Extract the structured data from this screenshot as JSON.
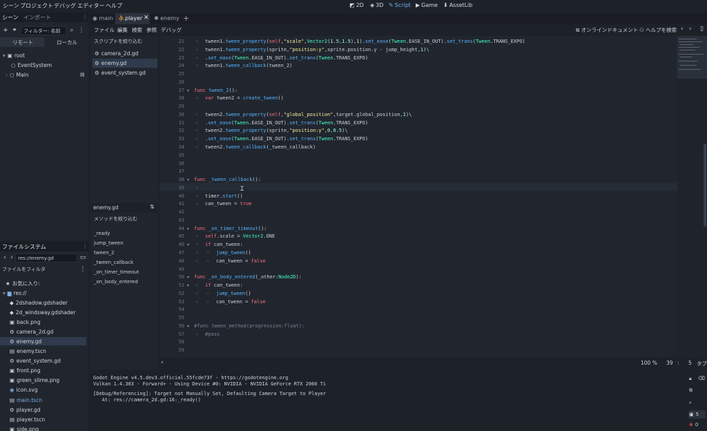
{
  "menubar": {
    "items": [
      "シーン",
      "プロジェクト",
      "デバッグ",
      "エディター",
      "ヘルプ"
    ],
    "workspaces": [
      {
        "label": "2D",
        "active": false
      },
      {
        "label": "3D",
        "active": false
      },
      {
        "label": "Script",
        "active": true
      },
      {
        "label": "Game",
        "active": false
      },
      {
        "label": "AssetLib",
        "active": false
      }
    ]
  },
  "scene_dock": {
    "tabs": [
      "シーン",
      "インポート"
    ],
    "filter_placeholder": "フィルター: 名前",
    "remote_label": "リモート",
    "local_label": "ローカル",
    "tree": [
      {
        "name": "root",
        "depth": 0
      },
      {
        "name": "EventSystem",
        "depth": 1
      },
      {
        "name": "Main",
        "depth": 1
      }
    ]
  },
  "scene_tabs": [
    {
      "label": "main",
      "active": false
    },
    {
      "label": "player",
      "active": true
    },
    {
      "label": "enemy",
      "active": false
    }
  ],
  "script_menu": [
    "ファイル",
    "編集",
    "検索",
    "参照",
    "デバッグ"
  ],
  "script_toolbar": {
    "online_docs": "オンラインドキュメント",
    "help_search": "ヘルプを検索"
  },
  "script_list": {
    "filter_placeholder": "スクリプトを絞り込む",
    "items": [
      "camera_2d.gd",
      "enemy.gd",
      "event_system.gd"
    ],
    "selected": 1,
    "current_file": "enemy.gd",
    "method_filter_placeholder": "メソッドを絞り込む",
    "methods": [
      "_ready",
      "jump_tween",
      "tween_2",
      "_tween_callback",
      "_on_timer_timeout",
      "_on_body_entered"
    ]
  },
  "editor": {
    "lines": [
      {
        "n": "21",
        "indent": 1,
        "html": "tween1.<span class='fn'>tween_property</span>(<span class='kw'>self</span>,<span class='str'>\"scale\"</span>,<span class='ty'>Vector2</span>(<span class='num'>1.5</span>,<span class='num'>1.5</span>),<span class='num'>1</span>).<span class='fn'>set_ease</span>(<span class='ty'>Tween</span>.EASE_IN_OUT).<span class='fn'>set_trans</span>(<span class='ty'>Tween</span>.TRANS_EXPO)"
      },
      {
        "n": "22",
        "indent": 1,
        "html": "tween1.<span class='fn'>tween_property</span>(sprite,<span class='str'>\"position:y\"</span>,sprite.position.y - jump_height,<span class='num'>1</span>)\\"
      },
      {
        "n": "23",
        "indent": 1,
        "html": ".<span class='fn'>set_ease</span>(<span class='ty'>Tween</span>.EASE_IN_OUT).<span class='fn'>set_trans</span>(<span class='ty'>Tween</span>.TRANS_EXPO)"
      },
      {
        "n": "24",
        "indent": 1,
        "html": "tween1.<span class='fn'>tween_callback</span>(tween_2)"
      },
      {
        "n": "25",
        "indent": 0,
        "html": ""
      },
      {
        "n": "26",
        "indent": 0,
        "html": ""
      },
      {
        "n": "27",
        "indent": 0,
        "fold": true,
        "html": "<span class='kw'>func</span> <span class='fn'>tween_2</span>():"
      },
      {
        "n": "28",
        "indent": 1,
        "html": "<span class='kw'>var</span> tween2 = <span class='fn'>create_tween</span>()"
      },
      {
        "n": "29",
        "indent": 0,
        "html": ""
      },
      {
        "n": "30",
        "indent": 1,
        "html": "tween2.<span class='fn'>tween_property</span>(<span class='kw'>self</span>,<span class='str'>\"global_position\"</span>,target.global_position,<span class='num'>1</span>)\\"
      },
      {
        "n": "31",
        "indent": 1,
        "html": ".<span class='fn'>set_ease</span>(<span class='ty'>Tween</span>.EASE_IN_OUT).<span class='fn'>set_trans</span>(<span class='ty'>Tween</span>.TRANS_EXPO)"
      },
      {
        "n": "32",
        "indent": 1,
        "html": "tween2.<span class='fn'>tween_property</span>(sprite,<span class='str'>\"position:y\"</span>,<span class='num'>0</span>,<span class='num'>0.5</span>)\\"
      },
      {
        "n": "33",
        "indent": 1,
        "html": ".<span class='fn'>set_ease</span>(<span class='ty'>Tween</span>.EASE_IN_OUT).<span class='fn'>set_trans</span>(<span class='ty'>Tween</span>.TRANS_EXPO)"
      },
      {
        "n": "34",
        "indent": 1,
        "html": "tween2.<span class='fn'>tween_callback</span>(_tween_callback)"
      },
      {
        "n": "35",
        "indent": 0,
        "html": ""
      },
      {
        "n": "36",
        "indent": 0,
        "html": ""
      },
      {
        "n": "37",
        "indent": 0,
        "html": ""
      },
      {
        "n": "38",
        "indent": 0,
        "fold": true,
        "html": "<span class='kw'>func</span> <span class='fn'>_tween_callback</span>():"
      },
      {
        "n": "39",
        "indent": 1,
        "current": true,
        "html": ""
      },
      {
        "n": "40",
        "indent": 1,
        "html": "timer.<span class='fn'>start</span>()"
      },
      {
        "n": "41",
        "indent": 1,
        "html": "can_tween = <span class='kw'>true</span>"
      },
      {
        "n": "42",
        "indent": 0,
        "html": ""
      },
      {
        "n": "43",
        "indent": 0,
        "html": ""
      },
      {
        "n": "44",
        "indent": 0,
        "fold": true,
        "html": "<span class='kw'>func</span> <span class='fn'>_on_timer_timeout</span>():"
      },
      {
        "n": "45",
        "indent": 1,
        "html": "<span class='kw'>self</span>.scale = <span class='ty'>Vector2</span>.ONE"
      },
      {
        "n": "46",
        "indent": 1,
        "fold": true,
        "html": "<span class='kw'>if</span> can_tween:"
      },
      {
        "n": "47",
        "indent": 2,
        "html": "<span class='fn'>jump_tween</span>()"
      },
      {
        "n": "48",
        "indent": 2,
        "html": "can_tween = <span class='kw'>false</span>"
      },
      {
        "n": "49",
        "indent": 0,
        "html": ""
      },
      {
        "n": "50",
        "indent": 0,
        "fold": true,
        "html": "<span class='kw'>func</span> <span class='fn'>_on_body_entered</span>(_other:<span class='ty'>Node2D</span>):"
      },
      {
        "n": "51",
        "indent": 1,
        "fold": true,
        "html": "<span class='kw'>if</span> can_tween:"
      },
      {
        "n": "52",
        "indent": 2,
        "html": "<span class='fn'>jump_tween</span>()"
      },
      {
        "n": "53",
        "indent": 2,
        "html": "can_tween = <span class='kw'>false</span>"
      },
      {
        "n": "54",
        "indent": 0,
        "html": ""
      },
      {
        "n": "55",
        "indent": 0,
        "html": ""
      },
      {
        "n": "56",
        "indent": 0,
        "fold": true,
        "html": "<span class='cm'>#func tween_method(progression:float):</span>"
      },
      {
        "n": "57",
        "indent": 1,
        "html": "<span class='cm'>#pass</span>"
      },
      {
        "n": "58",
        "indent": 0,
        "html": ""
      },
      {
        "n": "59",
        "indent": 0,
        "html": ""
      }
    ],
    "status_zoom": "100 %",
    "status_line": "39",
    "status_col": "5",
    "status_tab": "タブ"
  },
  "filesystem": {
    "tab": "ファイルシステム",
    "path": "res://enemy.gd",
    "filter_placeholder": "ファイルをフィルタ",
    "favorites": "お気に入り:",
    "root": "res://",
    "files": [
      {
        "name": "2dshadow.gdshader",
        "icon": "shader"
      },
      {
        "name": "2d_windsway.gdshader",
        "icon": "shader"
      },
      {
        "name": "back.png",
        "icon": "image"
      },
      {
        "name": "camera_2d.gd",
        "icon": "script"
      },
      {
        "name": "enemy.gd",
        "icon": "script",
        "selected": true
      },
      {
        "name": "enemy.tscn",
        "icon": "scene"
      },
      {
        "name": "event_system.gd",
        "icon": "script"
      },
      {
        "name": "front.png",
        "icon": "image"
      },
      {
        "name": "green_slime.png",
        "icon": "image"
      },
      {
        "name": "icon.svg",
        "icon": "svg"
      },
      {
        "name": "main.tscn",
        "icon": "scene",
        "highlight": true
      },
      {
        "name": "player.gd",
        "icon": "script"
      },
      {
        "name": "player.tscn",
        "icon": "scene"
      },
      {
        "name": "side.png",
        "icon": "image"
      }
    ]
  },
  "output": {
    "lines": [
      "Godot Engine v4.5.dev3.official.55fcde73f - https://godotengine.org",
      "Vulkan 1.4.303 - Forward+ - Using Device #0: NVIDIA - NVIDIA GeForce RTX 2060 Ti",
      "",
      "[Debug/Referencing]: Target not Manually Set, Defaulting Camera Target to Player",
      "   At: res://camera_2d.gd:16:_ready()"
    ],
    "counts": {
      "messages": "5",
      "errors": "0",
      "warnings": "0"
    }
  },
  "colors": {
    "accent": "#6fb1f5",
    "bg": "#1d2229",
    "panel": "#21262e"
  }
}
